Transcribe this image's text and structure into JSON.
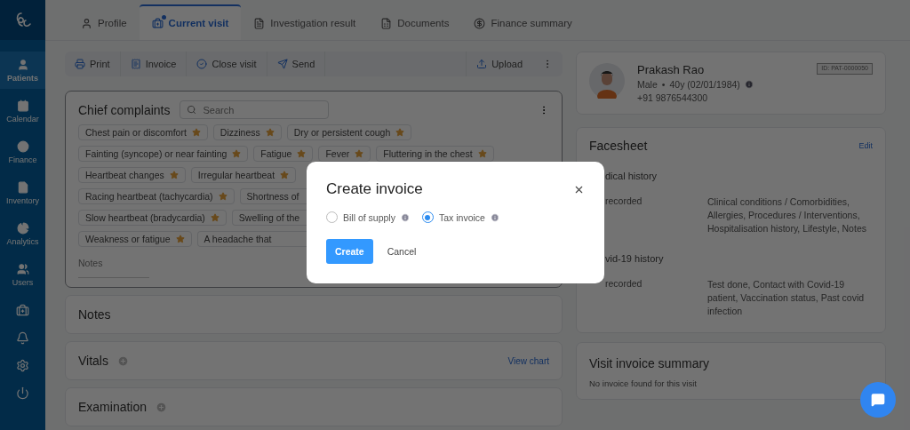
{
  "sidebar": {
    "items": [
      {
        "label": "Patients",
        "selected": true
      },
      {
        "label": "Calendar",
        "selected": false
      },
      {
        "label": "Finance",
        "selected": false
      },
      {
        "label": "Inventory",
        "selected": false
      },
      {
        "label": "Analytics",
        "selected": false
      },
      {
        "label": "Users",
        "selected": false
      }
    ]
  },
  "tabs": [
    {
      "label": "Profile",
      "selected": false
    },
    {
      "label": "Current visit",
      "selected": true
    },
    {
      "label": "Investigation result",
      "selected": false
    },
    {
      "label": "Documents",
      "selected": false
    },
    {
      "label": "Finance summary",
      "selected": false
    }
  ],
  "toolbar": {
    "actions": [
      "Print",
      "Invoice",
      "Close visit",
      "Send"
    ],
    "upload": "Upload"
  },
  "chief_complaints": {
    "title": "Chief complaints",
    "search_placeholder": "Search",
    "notes_label": "Notes",
    "chip_rows": [
      [
        {
          "label": "Chest pain or discomfort",
          "cut": false
        },
        {
          "label": "Dizziness",
          "cut": false
        },
        {
          "label": "Dry or persistent cough",
          "cut": false
        }
      ],
      [
        {
          "label": "Fainting (syncope) or near fainting",
          "cut": false
        },
        {
          "label": "Fatigue",
          "cut": false
        },
        {
          "label": "Fever",
          "cut": false
        },
        {
          "label": "Fluttering in the chest",
          "cut": false
        }
      ],
      [
        {
          "label": "Heartbeat changes",
          "cut": false
        },
        {
          "label": "Irregular heartbeat",
          "cut": false
        }
      ],
      [
        {
          "label": "Racing heartbeat (tachycardia)",
          "cut": false
        },
        {
          "label": "Shortness of",
          "cut": true
        }
      ],
      [
        {
          "label": "Slow heartbeat (bradycardia)",
          "cut": false
        },
        {
          "label": "Swelling of the",
          "cut": true
        }
      ],
      [
        {
          "label": "Weakness or fatigue",
          "cut": false
        },
        {
          "label": "A headache that",
          "cut": true
        }
      ]
    ]
  },
  "sections": [
    {
      "title": "Notes",
      "addable": false
    },
    {
      "title": "Vitals",
      "addable": true,
      "link": "View chart"
    },
    {
      "title": "Examination",
      "addable": true
    }
  ],
  "patient": {
    "name": "Prakash Rao",
    "gender": "Male",
    "separator": "•",
    "age": "40y (02/01/1984)",
    "phone": "+91 9876544300",
    "id": "ID: PAT-0000050"
  },
  "facesheet": {
    "title": "Facesheet",
    "edit": "Edit",
    "groups": [
      {
        "title": "dical history",
        "status": "recorded",
        "details": "Clinical conditions / Comorbidities, Allergies, Procedures / Interventions, Hospitalisation history, Lifestyle, Notes"
      },
      {
        "title": "vid-19 history",
        "status": "recorded",
        "details": "Test done, Contact with Covid-19 patient, Vaccination status, Past covid infection"
      }
    ]
  },
  "invoice_summary": {
    "title": "Visit invoice summary",
    "message": "No invoice found for this visit"
  },
  "modal": {
    "title": "Create invoice",
    "options": [
      {
        "label": "Bill of supply",
        "selected": false
      },
      {
        "label": "Tax invoice",
        "selected": true
      }
    ],
    "primary": "Create",
    "secondary": "Cancel"
  }
}
